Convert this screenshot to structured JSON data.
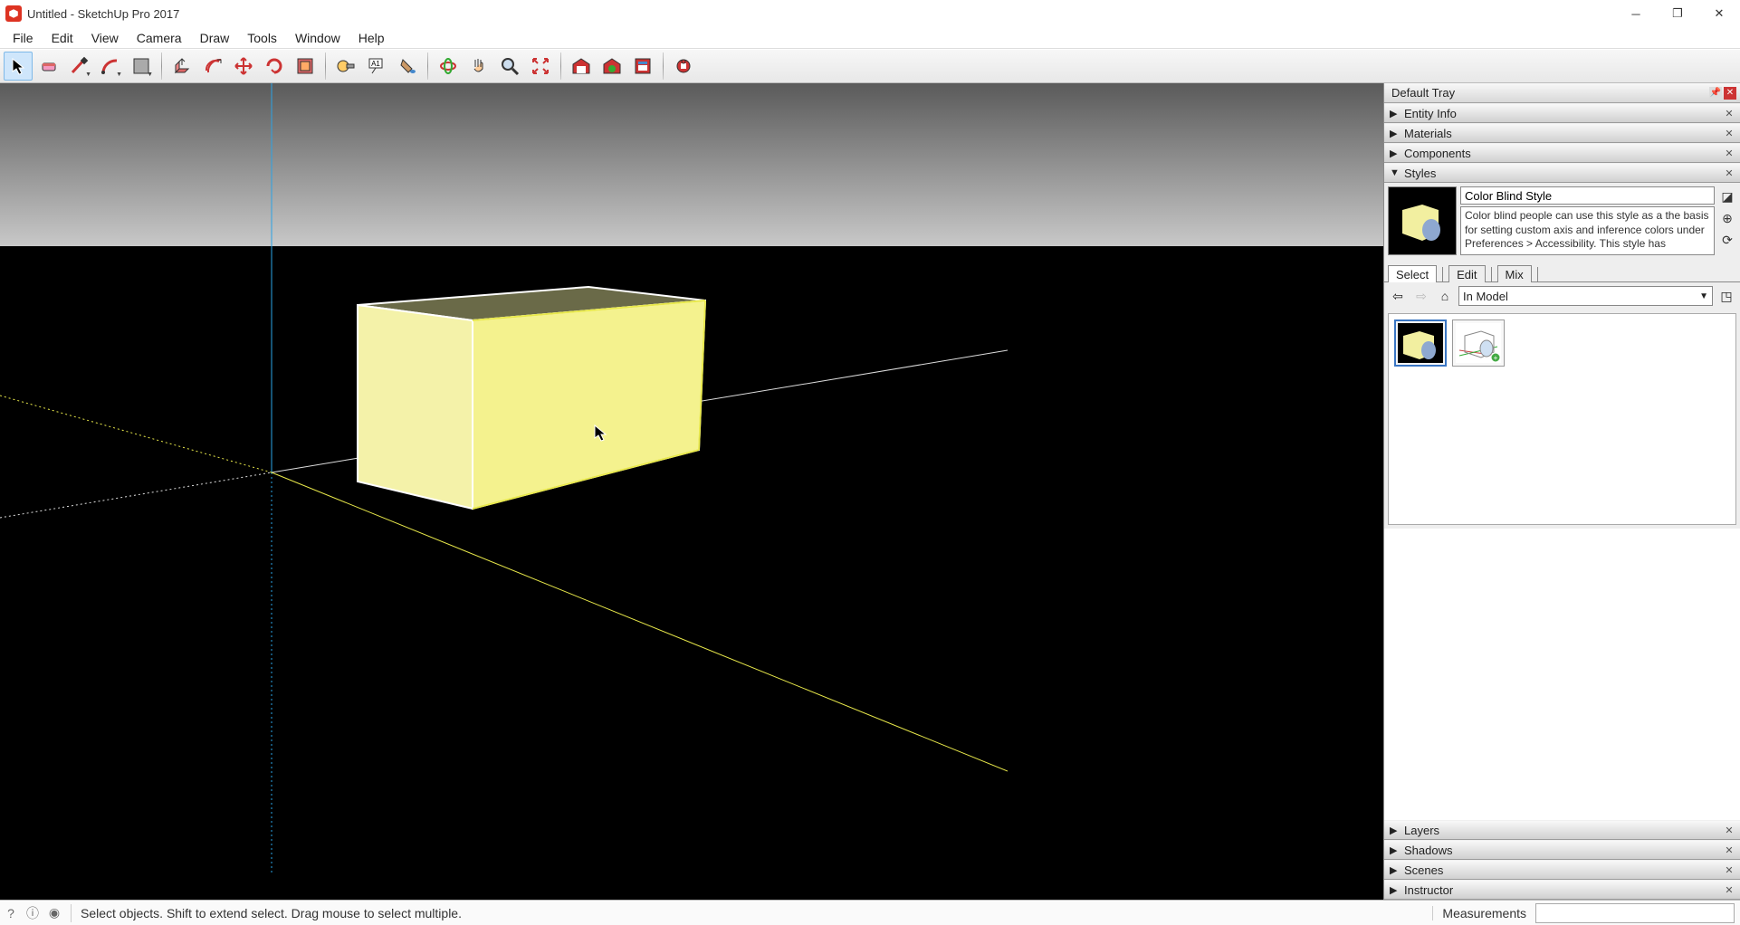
{
  "window": {
    "title": "Untitled - SketchUp Pro 2017"
  },
  "menu": [
    "File",
    "Edit",
    "View",
    "Camera",
    "Draw",
    "Tools",
    "Window",
    "Help"
  ],
  "toolbar": {
    "items": [
      {
        "name": "select",
        "active": true,
        "dropdown": false
      },
      {
        "name": "eraser",
        "dropdown": false
      },
      {
        "name": "lines",
        "dropdown": true
      },
      {
        "name": "arcs",
        "dropdown": true
      },
      {
        "name": "shapes",
        "dropdown": true
      },
      {
        "sep": true
      },
      {
        "name": "pushpull",
        "dropdown": false
      },
      {
        "name": "offset",
        "dropdown": false
      },
      {
        "name": "move",
        "dropdown": false
      },
      {
        "name": "rotate",
        "dropdown": false
      },
      {
        "name": "scale",
        "dropdown": false
      },
      {
        "sep": true
      },
      {
        "name": "tape",
        "dropdown": false
      },
      {
        "name": "text",
        "dropdown": false
      },
      {
        "name": "paint",
        "dropdown": false
      },
      {
        "sep": true
      },
      {
        "name": "orbit",
        "dropdown": false
      },
      {
        "name": "pan",
        "dropdown": false
      },
      {
        "name": "zoom",
        "dropdown": false
      },
      {
        "name": "zoom-extents",
        "dropdown": false
      },
      {
        "sep": true
      },
      {
        "name": "warehouse",
        "dropdown": false
      },
      {
        "name": "ext-warehouse",
        "dropdown": false
      },
      {
        "name": "layout",
        "dropdown": false
      },
      {
        "sep": true
      },
      {
        "name": "extensions",
        "dropdown": false
      }
    ]
  },
  "tray": {
    "title": "Default Tray",
    "panels_top": [
      {
        "label": "Entity Info",
        "expanded": false
      },
      {
        "label": "Materials",
        "expanded": false
      },
      {
        "label": "Components",
        "expanded": false
      },
      {
        "label": "Styles",
        "expanded": true
      }
    ],
    "styles": {
      "name": "Color Blind Style",
      "description": "Color blind people can use this style as a the basis for setting custom axis and inference colors under Preferences > Accessibility.  This style has",
      "tabs": [
        "Select",
        "Edit",
        "Mix"
      ],
      "active_tab": 0,
      "nav_label": "In Model"
    },
    "panels_bottom": [
      {
        "label": "Layers"
      },
      {
        "label": "Shadows"
      },
      {
        "label": "Scenes"
      },
      {
        "label": "Instructor"
      }
    ]
  },
  "status": {
    "text": "Select objects. Shift to extend select. Drag mouse to select multiple.",
    "measurements_label": "Measurements"
  }
}
